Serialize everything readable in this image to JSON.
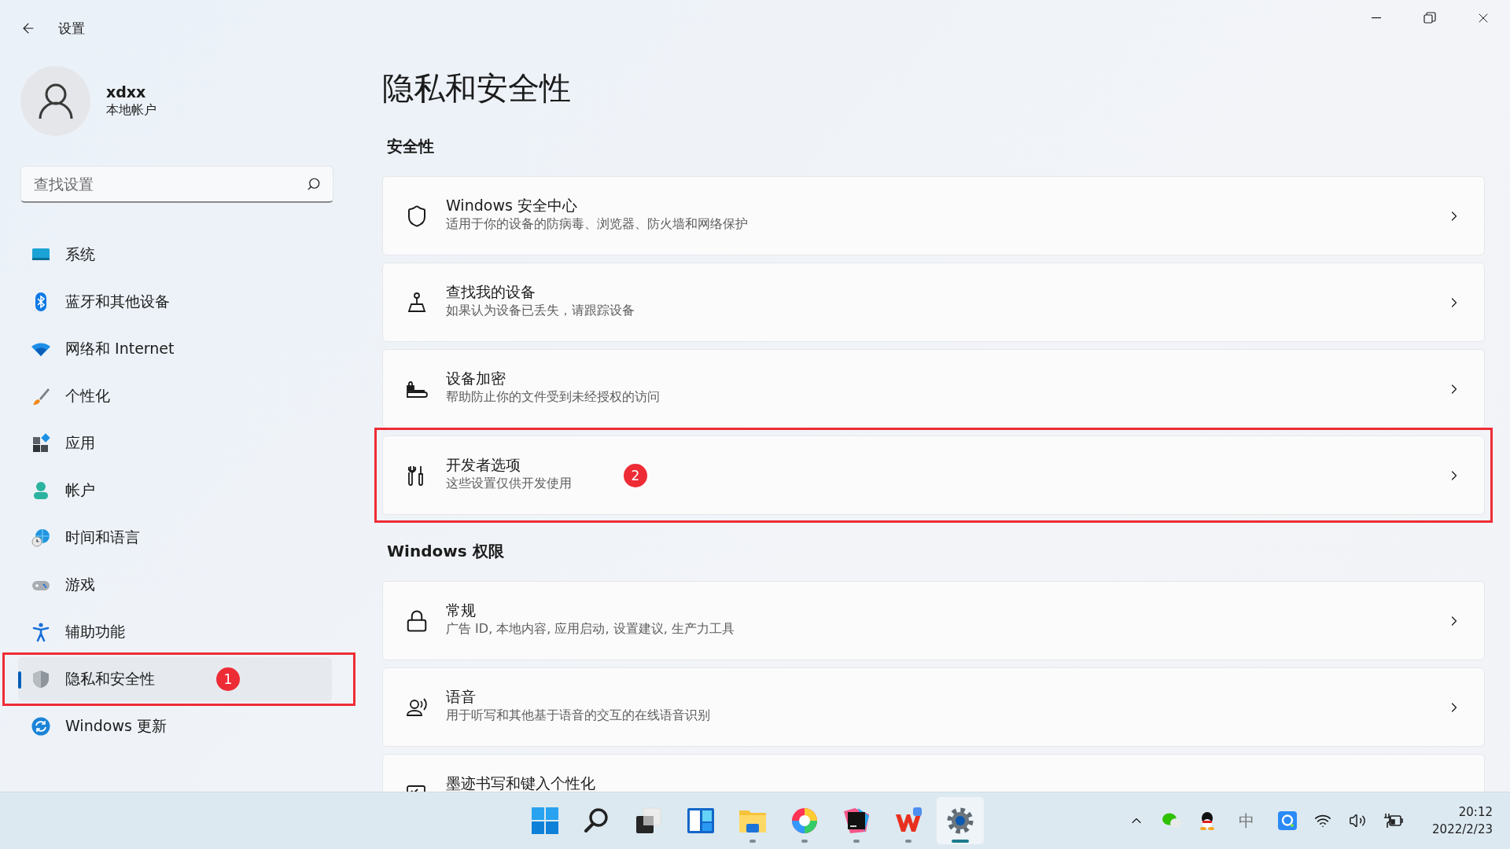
{
  "window": {
    "title": "设置"
  },
  "account": {
    "name": "xdxx",
    "type": "本地帐户"
  },
  "search": {
    "placeholder": "查找设置"
  },
  "nav": [
    {
      "kind": "system",
      "label": "系统",
      "selected": false,
      "highlighted": false
    },
    {
      "kind": "bluetooth",
      "label": "蓝牙和其他设备",
      "selected": false,
      "highlighted": false
    },
    {
      "kind": "network",
      "label": "网络和 Internet",
      "selected": false,
      "highlighted": false
    },
    {
      "kind": "personalization",
      "label": "个性化",
      "selected": false,
      "highlighted": false
    },
    {
      "kind": "apps",
      "label": "应用",
      "selected": false,
      "highlighted": false
    },
    {
      "kind": "accounts",
      "label": "帐户",
      "selected": false,
      "highlighted": false
    },
    {
      "kind": "time",
      "label": "时间和语言",
      "selected": false,
      "highlighted": false
    },
    {
      "kind": "gaming",
      "label": "游戏",
      "selected": false,
      "highlighted": false
    },
    {
      "kind": "accessibility",
      "label": "辅助功能",
      "selected": false,
      "highlighted": false
    },
    {
      "kind": "privacy",
      "label": "隐私和安全性",
      "selected": true,
      "highlighted": true,
      "badge": "1"
    },
    {
      "kind": "update",
      "label": "Windows 更新",
      "selected": false,
      "highlighted": false
    }
  ],
  "page": {
    "title": "隐私和安全性"
  },
  "sections": [
    {
      "title": "安全性",
      "items": [
        {
          "kind": "shield",
          "title": "Windows 安全中心",
          "description": "适用于你的设备的防病毒、浏览器、防火墙和网络保护",
          "highlighted": false
        },
        {
          "kind": "find",
          "title": "查找我的设备",
          "description": "如果认为设备已丢失，请跟踪设备",
          "highlighted": false
        },
        {
          "kind": "encryption",
          "title": "设备加密",
          "description": "帮助防止你的文件受到未经授权的访问",
          "highlighted": false
        },
        {
          "kind": "developer",
          "title": "开发者选项",
          "description": "这些设置仅供开发使用",
          "highlighted": true,
          "badge": "2"
        }
      ]
    },
    {
      "title": "Windows 权限",
      "items": [
        {
          "kind": "lock",
          "title": "常规",
          "description": "广告 ID, 本地内容, 应用启动, 设置建议, 生产力工具",
          "highlighted": false
        },
        {
          "kind": "voice",
          "title": "语音",
          "description": "用于听写和其他基于语音的交互的在线语音识别",
          "highlighted": false
        },
        {
          "kind": "ink",
          "title": "墨迹书写和键入个性化",
          "highlighted": false
        }
      ]
    }
  ],
  "taskbar": {
    "apps": [
      {
        "kind": "start",
        "running": false,
        "selected": false
      },
      {
        "kind": "search",
        "running": false,
        "selected": false
      },
      {
        "kind": "taskview",
        "running": false,
        "selected": false
      },
      {
        "kind": "widgets",
        "running": false,
        "selected": false
      },
      {
        "kind": "explorer",
        "running": true,
        "selected": false
      },
      {
        "kind": "colorwheel",
        "running": true,
        "selected": false
      },
      {
        "kind": "ide",
        "running": true,
        "selected": false
      },
      {
        "kind": "office",
        "running": true,
        "selected": false
      },
      {
        "kind": "settings",
        "running": true,
        "selected": true
      }
    ],
    "tray": {
      "ime": "中",
      "time": "20:12",
      "date": "2022/2/23"
    }
  }
}
